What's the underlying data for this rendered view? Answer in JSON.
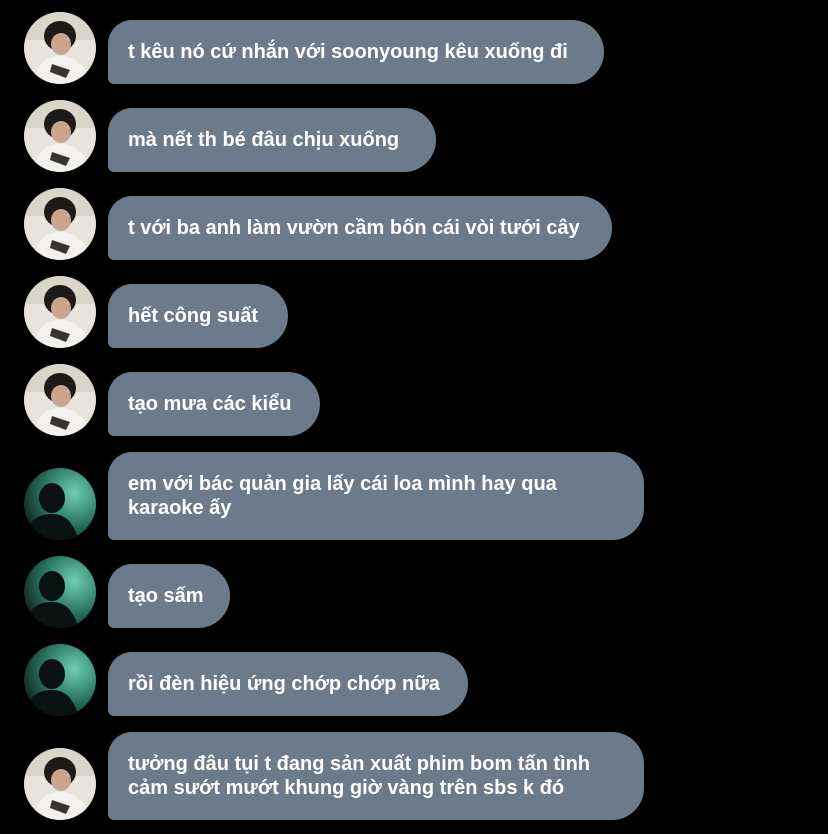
{
  "messages": [
    {
      "sender": "friend-a",
      "text": "t kêu nó cứ nhắn với soonyoung kêu xuống đi"
    },
    {
      "sender": "friend-a",
      "text": "mà nết th bé đâu chịu xuống"
    },
    {
      "sender": "friend-a",
      "text": "t với ba anh làm vườn cầm bốn cái vòi tưới cây"
    },
    {
      "sender": "friend-a",
      "text": "hết công suất"
    },
    {
      "sender": "friend-a",
      "text": "tạo mưa các kiểu"
    },
    {
      "sender": "friend-b",
      "text": "em với bác quản gia lấy cái loa mình hay qua karaoke ấy"
    },
    {
      "sender": "friend-b",
      "text": "tạo sấm"
    },
    {
      "sender": "friend-b",
      "text": "rồi đèn hiệu ứng chớp chớp nữa"
    },
    {
      "sender": "friend-a",
      "text": "tưởng đâu tụi t đang sản xuất phim bom tấn tình cảm sướt mướt khung giờ vàng trên sbs k đó"
    }
  ],
  "colors": {
    "background": "#000000",
    "bubble": "#6c7b8c",
    "text": "#ffffff"
  },
  "icons": {
    "friend-a": "avatar-photo-person-white-shirt",
    "friend-b": "avatar-photo-silhouette-teal"
  }
}
